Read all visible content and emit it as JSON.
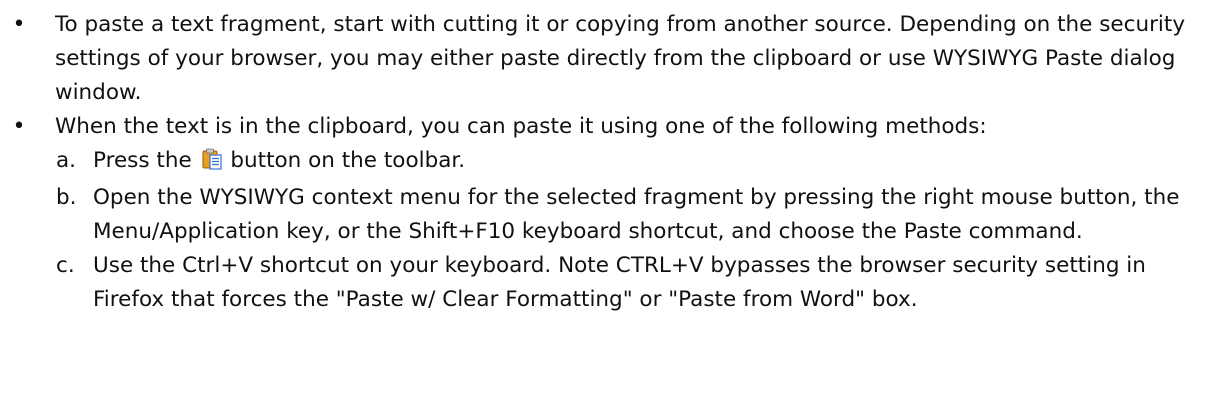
{
  "bullets": [
    {
      "marker": "•",
      "text": "To paste a text fragment, start with cutting it or copying from another source. Depending on the security settings of your browser, you may either paste directly from the clipboard or use WYSIWYG Paste dialog window."
    },
    {
      "marker": "•",
      "text": "When the text is in the clipboard, you can paste it using one of the following methods:"
    }
  ],
  "methods": [
    {
      "marker": "a.",
      "text_before_icon": "Press the",
      "icon": "paste-icon",
      "text_after_icon": "button on the toolbar."
    },
    {
      "marker": "b.",
      "text": "Open the WYSIWYG context menu for the selected fragment by pressing the right mouse button, the Menu/Application key, or the Shift+F10 keyboard shortcut, and choose the Paste command."
    },
    {
      "marker": "c.",
      "text": "Use the Ctrl+V shortcut on your keyboard. Note CTRL+V bypasses the browser security setting in Firefox that forces the \"Paste w/ Clear Formatting\" or \"Paste from Word\" box."
    }
  ],
  "colors": {
    "text": "#111111",
    "icon_clipboard": "#e8a020",
    "icon_paper": "#3a6fd0"
  }
}
